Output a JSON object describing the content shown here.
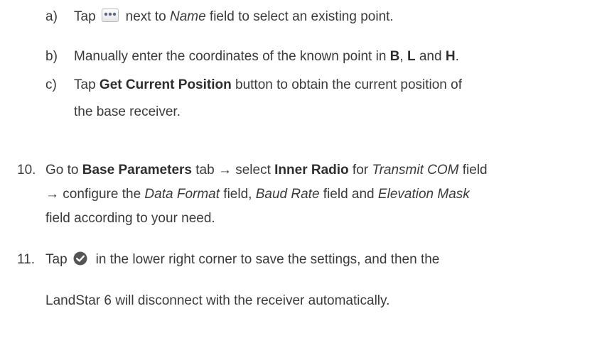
{
  "steps": {
    "a": {
      "marker": "a)",
      "pre": "Tap",
      "icon": "more-dots-icon",
      "name_field": "Name",
      "post": " field to select an existing point.",
      "next_to": "next to "
    },
    "b": {
      "marker": "b)",
      "text1": "Manually enter the coordinates of the known point in ",
      "b": "B",
      "sep1": ", ",
      "l": "L",
      "and": " and ",
      "h": "H",
      "end": "."
    },
    "c": {
      "marker": "c)",
      "pre": "Tap ",
      "button": "Get Current Position",
      "post": " button to obtain the current position of",
      "line2": "the base receiver."
    },
    "s10": {
      "marker": "10.",
      "go_to": "Go to ",
      "tab": "Base Parameters",
      "tab_post": " tab → select ",
      "radio": "Inner Radio",
      "for": " for ",
      "transmit": "Transmit COM",
      "field": " field",
      "arrow_cfg": "→ configure the ",
      "data_format": "Data Format",
      "field_comma": " field, ",
      "baud": "Baud Rate",
      "field_and": " field and ",
      "elev": "Elevation Mask",
      "line3": "field according to your need."
    },
    "s11": {
      "marker": "11.",
      "pre": "Tap",
      "icon": "check-circle-icon",
      "post": "in the lower right corner to save the settings, and then the",
      "line2": "LandStar 6 will disconnect with the receiver automatically."
    }
  },
  "colors": {
    "text": "#3a3a3a",
    "icon_gray": "#555555"
  }
}
